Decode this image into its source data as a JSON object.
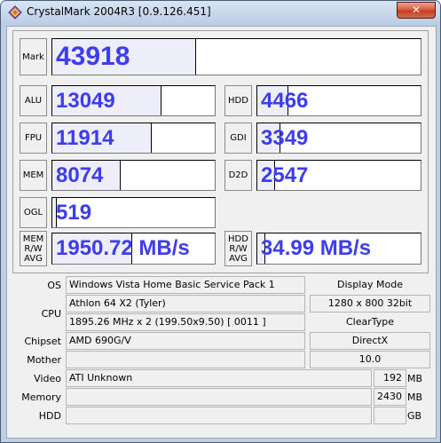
{
  "window": {
    "title": "CrystalMark 2004R3 [0.9.126.451]",
    "close_glyph": "✕"
  },
  "scores": {
    "mark": {
      "label": "Mark",
      "value": "43918",
      "fill": 0.39
    },
    "alu": {
      "label": "ALU",
      "value": "13049",
      "fill": 0.67
    },
    "hdd": {
      "label": "HDD",
      "value": "4466",
      "fill": 0.19
    },
    "fpu": {
      "label": "FPU",
      "value": "11914",
      "fill": 0.61
    },
    "gdi": {
      "label": "GDI",
      "value": "3349",
      "fill": 0.14
    },
    "mem": {
      "label": "MEM",
      "value": "8074",
      "fill": 0.42
    },
    "d2d": {
      "label": "D2D",
      "value": "2547",
      "fill": 0.11
    },
    "ogl": {
      "label": "OGL",
      "value": "519",
      "fill": 0.03
    },
    "mem_rw": {
      "label_lines": [
        "MEM",
        "R/W",
        "AVG"
      ],
      "value": "1950.72 MB/s",
      "fill": 0.49
    },
    "hdd_rw": {
      "label_lines": [
        "HDD",
        "R/W",
        "AVG"
      ],
      "value": "34.99 MB/s",
      "fill": 0.05
    }
  },
  "info": {
    "os_label": "OS",
    "os_value": "Windows Vista Home Basic Service Pack 1",
    "display_mode_label": "Display Mode",
    "display_mode_value": "1280 x 800 32bit",
    "cpu_label": "CPU",
    "cpu_name": "Athlon 64 X2 (Tyler)",
    "cpu_clock": "1895.26 MHz x 2 (199.50x9.50) [ 0011 ]",
    "cleartype_label": "ClearType",
    "cleartype_value": "",
    "chipset_label": "Chipset",
    "chipset_value": "AMD 690G/V",
    "directx_label": "DirectX",
    "directx_value": "10.0",
    "mother_label": "Mother",
    "mother_value": "",
    "video_label": "Video",
    "video_value": "ATI Unknown",
    "video_mem": "192",
    "video_unit": "MB",
    "memory_label": "Memory",
    "memory_value": "",
    "memory_size": "2430",
    "memory_unit": "MB",
    "hdd_label": "HDD",
    "hdd_value": "",
    "hdd_size": "",
    "hdd_unit": "GB"
  }
}
